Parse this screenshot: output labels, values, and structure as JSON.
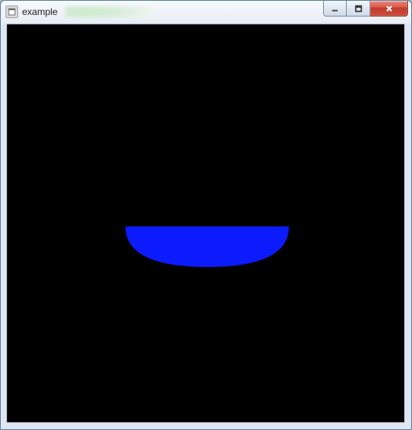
{
  "window": {
    "title": "example"
  },
  "canvas": {
    "background": "#000000",
    "shape": {
      "fill": "#0b1bfb",
      "top_y_ratio": 0.508,
      "left_x_ratio": 0.298,
      "right_x_ratio": 0.71,
      "bottom_y_ratio": 0.61
    }
  }
}
